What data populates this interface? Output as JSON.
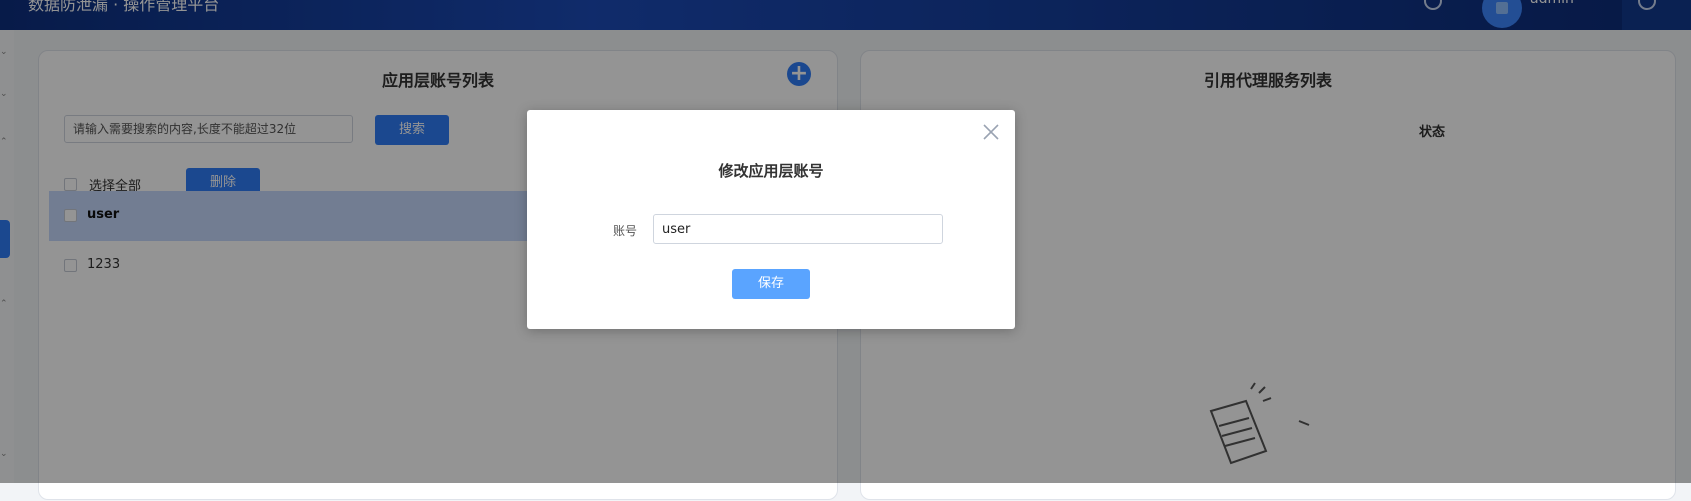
{
  "app": {
    "title": "数据防泄漏 · 操作管理平台",
    "user_name": "admin"
  },
  "left_panel": {
    "title": "应用层账号列表",
    "search_placeholder": "请输入需要搜索的内容,长度不能超过32位",
    "search_label": "搜索",
    "select_all_label": "选择全部",
    "delete_label": "删除",
    "accounts": [
      "user",
      "1233"
    ]
  },
  "right_panel": {
    "title": "引用代理服务列表",
    "status_header": "状态"
  },
  "modal": {
    "title": "修改应用层账号",
    "account_label": "账号",
    "account_value": "user",
    "save_label": "保存"
  },
  "colors": {
    "primary": "#2f7cf6",
    "save_button": "#5aa4ff",
    "selected_row": "#c4d8fb",
    "topbar_dark": "#0d2f7e"
  },
  "icons": {
    "add": "plus-circle-icon",
    "close": "close-icon",
    "help": "help-icon",
    "logout": "logout-icon"
  }
}
